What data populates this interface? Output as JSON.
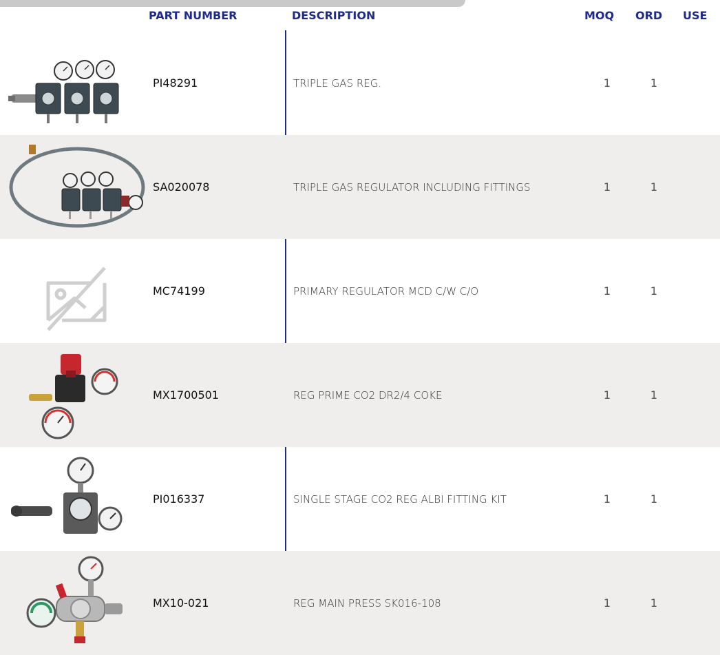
{
  "header": {
    "part_number": "PART NUMBER",
    "description": "DESCRIPTION",
    "moq": "MOQ",
    "ord": "ORD",
    "use": "USE"
  },
  "rows": [
    {
      "image": "triple-gas-regulator-photo",
      "part_number": "PI48291",
      "description": "TRIPLE GAS REG.",
      "moq": "1",
      "ord": "1",
      "use": ""
    },
    {
      "image": "triple-gas-regulator-with-hose-photo",
      "part_number": "SA020078",
      "description": "TRIPLE GAS REGULATOR INCLUDING FITTINGS",
      "moq": "1",
      "ord": "1",
      "use": ""
    },
    {
      "image": "no-image-placeholder-icon",
      "part_number": "MC74199",
      "description": "PRIMARY REGULATOR MCD C/W C/O",
      "moq": "1",
      "ord": "1",
      "use": ""
    },
    {
      "image": "co2-regulator-red-knob-photo",
      "part_number": "MX1700501",
      "description": "REG PRIME CO2 DR2/4 COKE",
      "moq": "1",
      "ord": "1",
      "use": ""
    },
    {
      "image": "single-stage-co2-regulator-photo",
      "part_number": "PI016337",
      "description": "SINGLE STAGE CO2 REG ALBI FITTING KIT",
      "moq": "1",
      "ord": "1",
      "use": ""
    },
    {
      "image": "main-pressure-regulator-photo",
      "part_number": "MX10-021",
      "description": "REG MAIN PRESS SK016-108",
      "moq": "1",
      "ord": "1",
      "use": ""
    }
  ],
  "colors": {
    "header_text": "#1e2a8c",
    "divider": "#1e2a8c",
    "shaded_row": "#efeeed"
  }
}
